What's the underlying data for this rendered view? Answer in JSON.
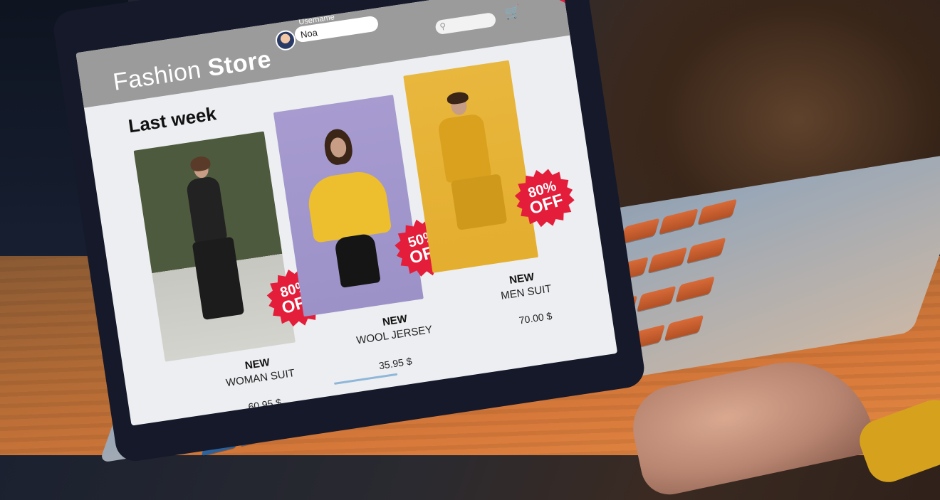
{
  "store": {
    "brand_light": "Fashion",
    "brand_bold": "Store",
    "username_label": "Username",
    "username_value": "Noa"
  },
  "section_title": "Last week",
  "products": [
    {
      "tag": "NEW",
      "name": "WOMAN SUIT",
      "price": "60.95 $",
      "discount_top": "80%",
      "discount_bottom": "OFF"
    },
    {
      "tag": "NEW",
      "name": "WOOL JERSEY",
      "price": "35.95 $",
      "discount_top": "50%",
      "discount_bottom": "OFF"
    },
    {
      "tag": "NEW",
      "name": "MEN SUIT",
      "price": "70.00 $",
      "discount_top": "80%",
      "discount_bottom": "OFF"
    }
  ],
  "icons": {
    "search": "search-icon",
    "cart": "cart-icon",
    "avatar": "avatar"
  },
  "colors": {
    "sale_red": "#e31d3a",
    "header_gray": "#9b9b9b",
    "screen_bg": "#eceef1"
  }
}
